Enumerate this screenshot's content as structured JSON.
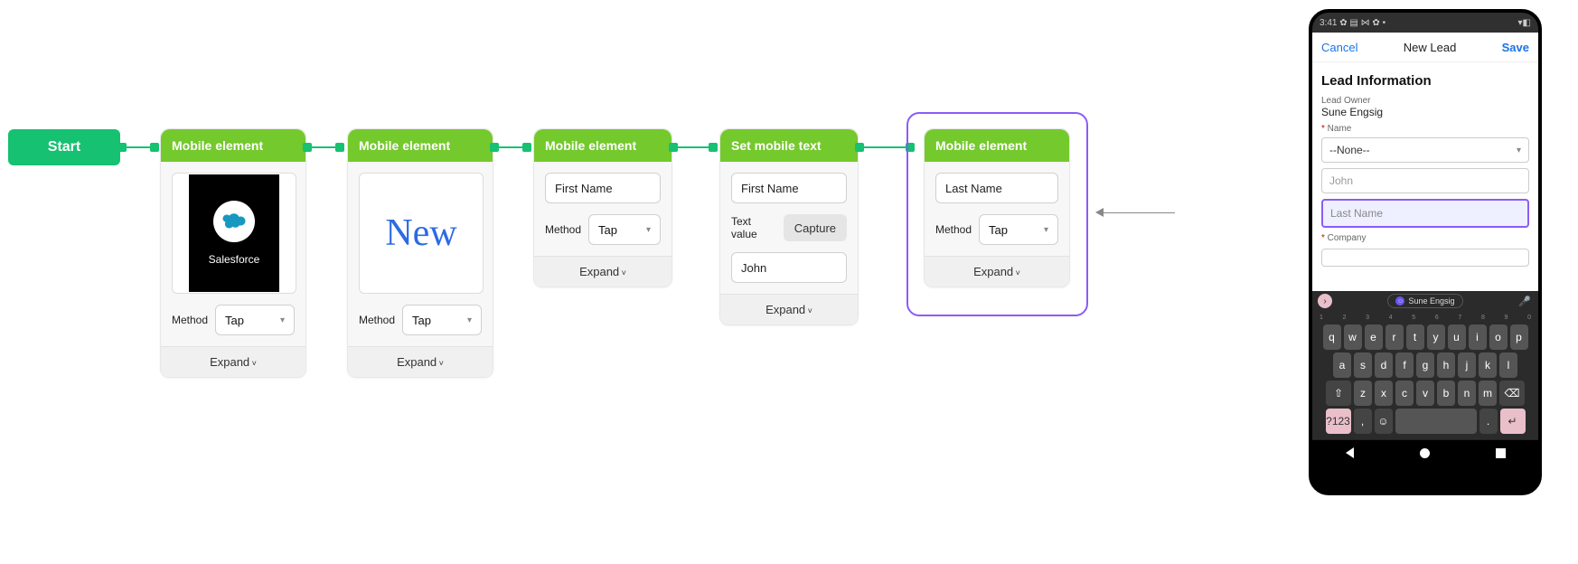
{
  "flow": {
    "start_label": "Start",
    "nodes": [
      {
        "title": "Mobile element",
        "method_label": "Method",
        "method_value": "Tap",
        "thumb_type": "salesforce",
        "salesforce_caption": "Salesforce",
        "expand": "Expand"
      },
      {
        "title": "Mobile element",
        "method_label": "Method",
        "method_value": "Tap",
        "thumb_type": "new",
        "new_text": "New",
        "expand": "Expand"
      },
      {
        "title": "Mobile element",
        "field_value": "First Name",
        "method_label": "Method",
        "method_value": "Tap",
        "expand": "Expand"
      },
      {
        "title": "Set mobile text",
        "field_value": "First Name",
        "text_value_label": "Text value",
        "capture_label": "Capture",
        "value_text": "John",
        "expand": "Expand"
      },
      {
        "title": "Mobile element",
        "field_value": "Last Name",
        "method_label": "Method",
        "method_value": "Tap",
        "expand": "Expand"
      }
    ]
  },
  "phone": {
    "status_time": "3:41",
    "status_icons": "✿ ▤ ⋈ ✿ •",
    "status_right": "▾◧",
    "cancel": "Cancel",
    "title": "New Lead",
    "save": "Save",
    "section": "Lead Information",
    "owner_label": "Lead Owner",
    "owner_value": "Sune Engsig",
    "name_label": "Name",
    "salutation": "--None--",
    "first_name": "John",
    "last_name_placeholder": "Last Name",
    "company_label": "Company",
    "suggestion": "Sune Engsig",
    "keyboard": {
      "nums": [
        "1",
        "2",
        "3",
        "4",
        "5",
        "6",
        "7",
        "8",
        "9",
        "0"
      ],
      "row1": [
        "q",
        "w",
        "e",
        "r",
        "t",
        "y",
        "u",
        "i",
        "o",
        "p"
      ],
      "row2": [
        "a",
        "s",
        "d",
        "f",
        "g",
        "h",
        "j",
        "k",
        "l"
      ],
      "row3": [
        "z",
        "x",
        "c",
        "v",
        "b",
        "n",
        "m"
      ],
      "shift": "⇧",
      "back": "⌫",
      "sym": "?123",
      "comma": ",",
      "emoji": "☺",
      "period": ".",
      "enter": "↵"
    }
  }
}
